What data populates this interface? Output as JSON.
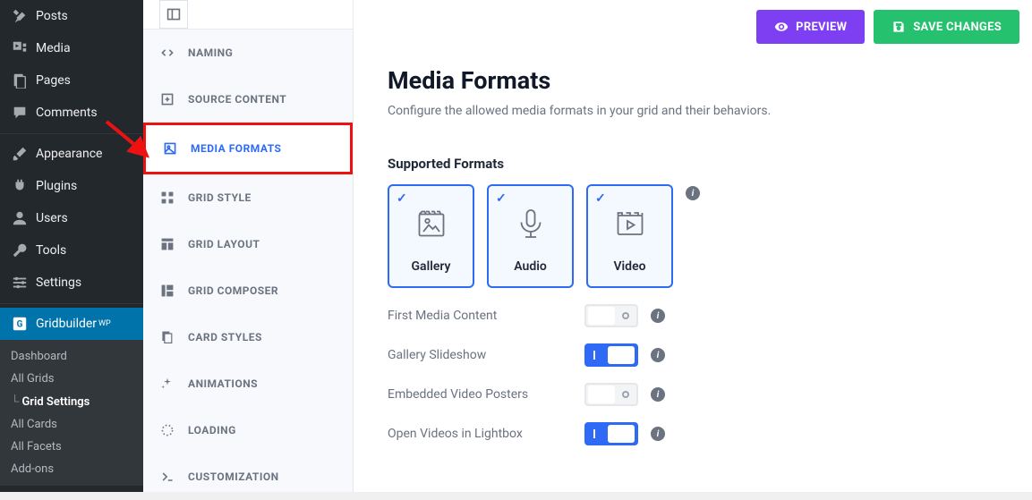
{
  "wp_menu": {
    "posts": "Posts",
    "media": "Media",
    "pages": "Pages",
    "comments": "Comments",
    "appearance": "Appearance",
    "plugins": "Plugins",
    "users": "Users",
    "tools": "Tools",
    "settings": "Settings",
    "gridbuilder": "Gridbuilder",
    "gridbuilder_sup": "WP"
  },
  "wp_submenu": {
    "dashboard": "Dashboard",
    "all_grids": "All Grids",
    "grid_settings": "Grid Settings",
    "all_cards": "All Cards",
    "all_facets": "All Facets",
    "addons": "Add-ons"
  },
  "settings_nav": {
    "naming": "NAMING",
    "source_content": "SOURCE CONTENT",
    "media_formats": "MEDIA FORMATS",
    "grid_style": "GRID STYLE",
    "grid_layout": "GRID LAYOUT",
    "grid_composer": "GRID COMPOSER",
    "card_styles": "CARD STYLES",
    "animations": "ANIMATIONS",
    "loading": "LOADING",
    "customization": "CUSTOMIZATION"
  },
  "actions": {
    "preview": "PREVIEW",
    "save": "SAVE CHANGES"
  },
  "main": {
    "title": "Media Formats",
    "description": "Configure the allowed media formats in your grid and their behaviors.",
    "section": "Supported Formats"
  },
  "formats": {
    "gallery": "Gallery",
    "audio": "Audio",
    "video": "Video"
  },
  "options": {
    "first_media": {
      "label": "First Media Content",
      "on": false
    },
    "gallery_slideshow": {
      "label": "Gallery Slideshow",
      "on": true
    },
    "embedded_posters": {
      "label": "Embedded Video Posters",
      "on": false
    },
    "open_lightbox": {
      "label": "Open Videos in Lightbox",
      "on": true
    }
  },
  "info_glyph": "i"
}
